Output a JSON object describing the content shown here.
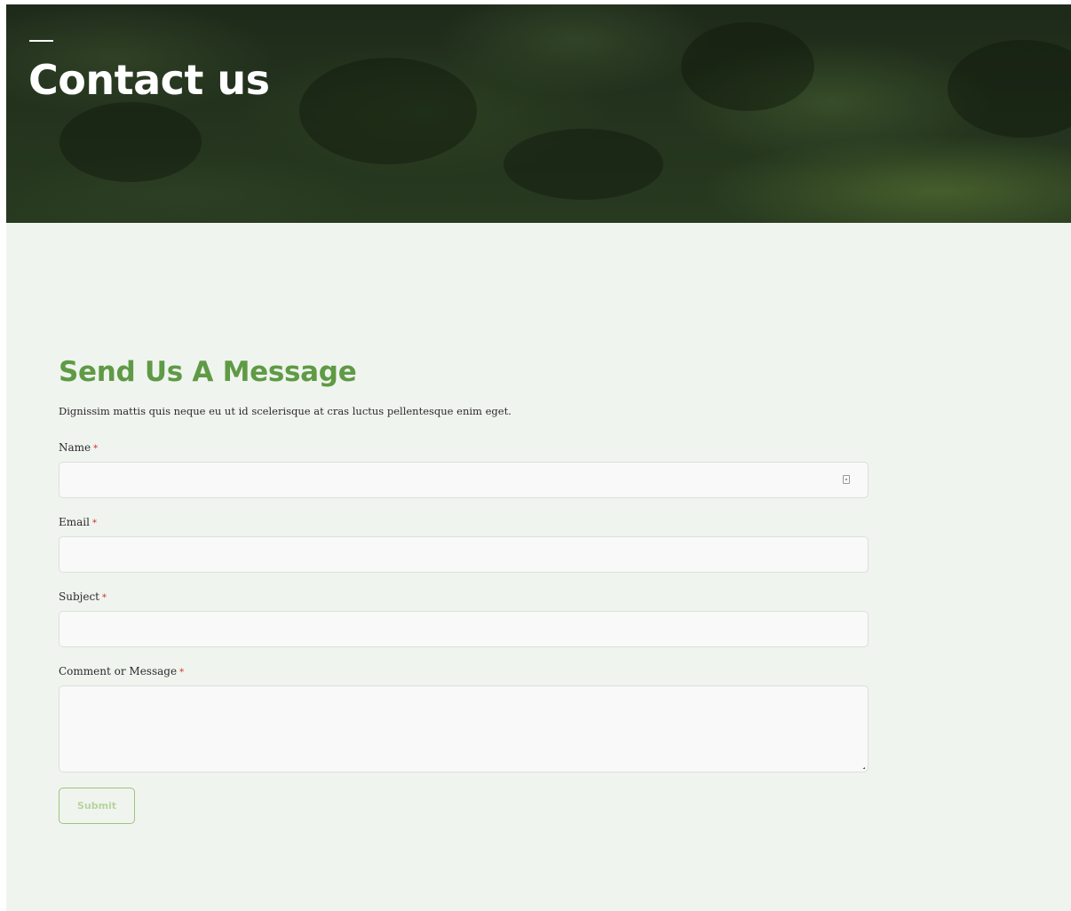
{
  "hero": {
    "title": "Contact us"
  },
  "form": {
    "title": "Send Us A Message",
    "description": "Dignissim mattis quis neque eu ut id scelerisque at cras luctus pellentesque enim eget.",
    "required_marker": "*",
    "fields": {
      "name": {
        "label": "Name",
        "value": ""
      },
      "email": {
        "label": "Email",
        "value": ""
      },
      "subject": {
        "label": "Subject",
        "value": ""
      },
      "message": {
        "label": "Comment or Message",
        "value": ""
      }
    },
    "submit_label": "Submit"
  },
  "colors": {
    "accent_green": "#5f9a45",
    "submit_border": "#9ec47f",
    "submit_text": "#b7d49c",
    "required": "#d0342c",
    "page_background": "#f0f4ef"
  },
  "icons": {
    "name_field_icon": "autofill-contact-icon",
    "message_field_icon": "resize-handle-icon"
  }
}
